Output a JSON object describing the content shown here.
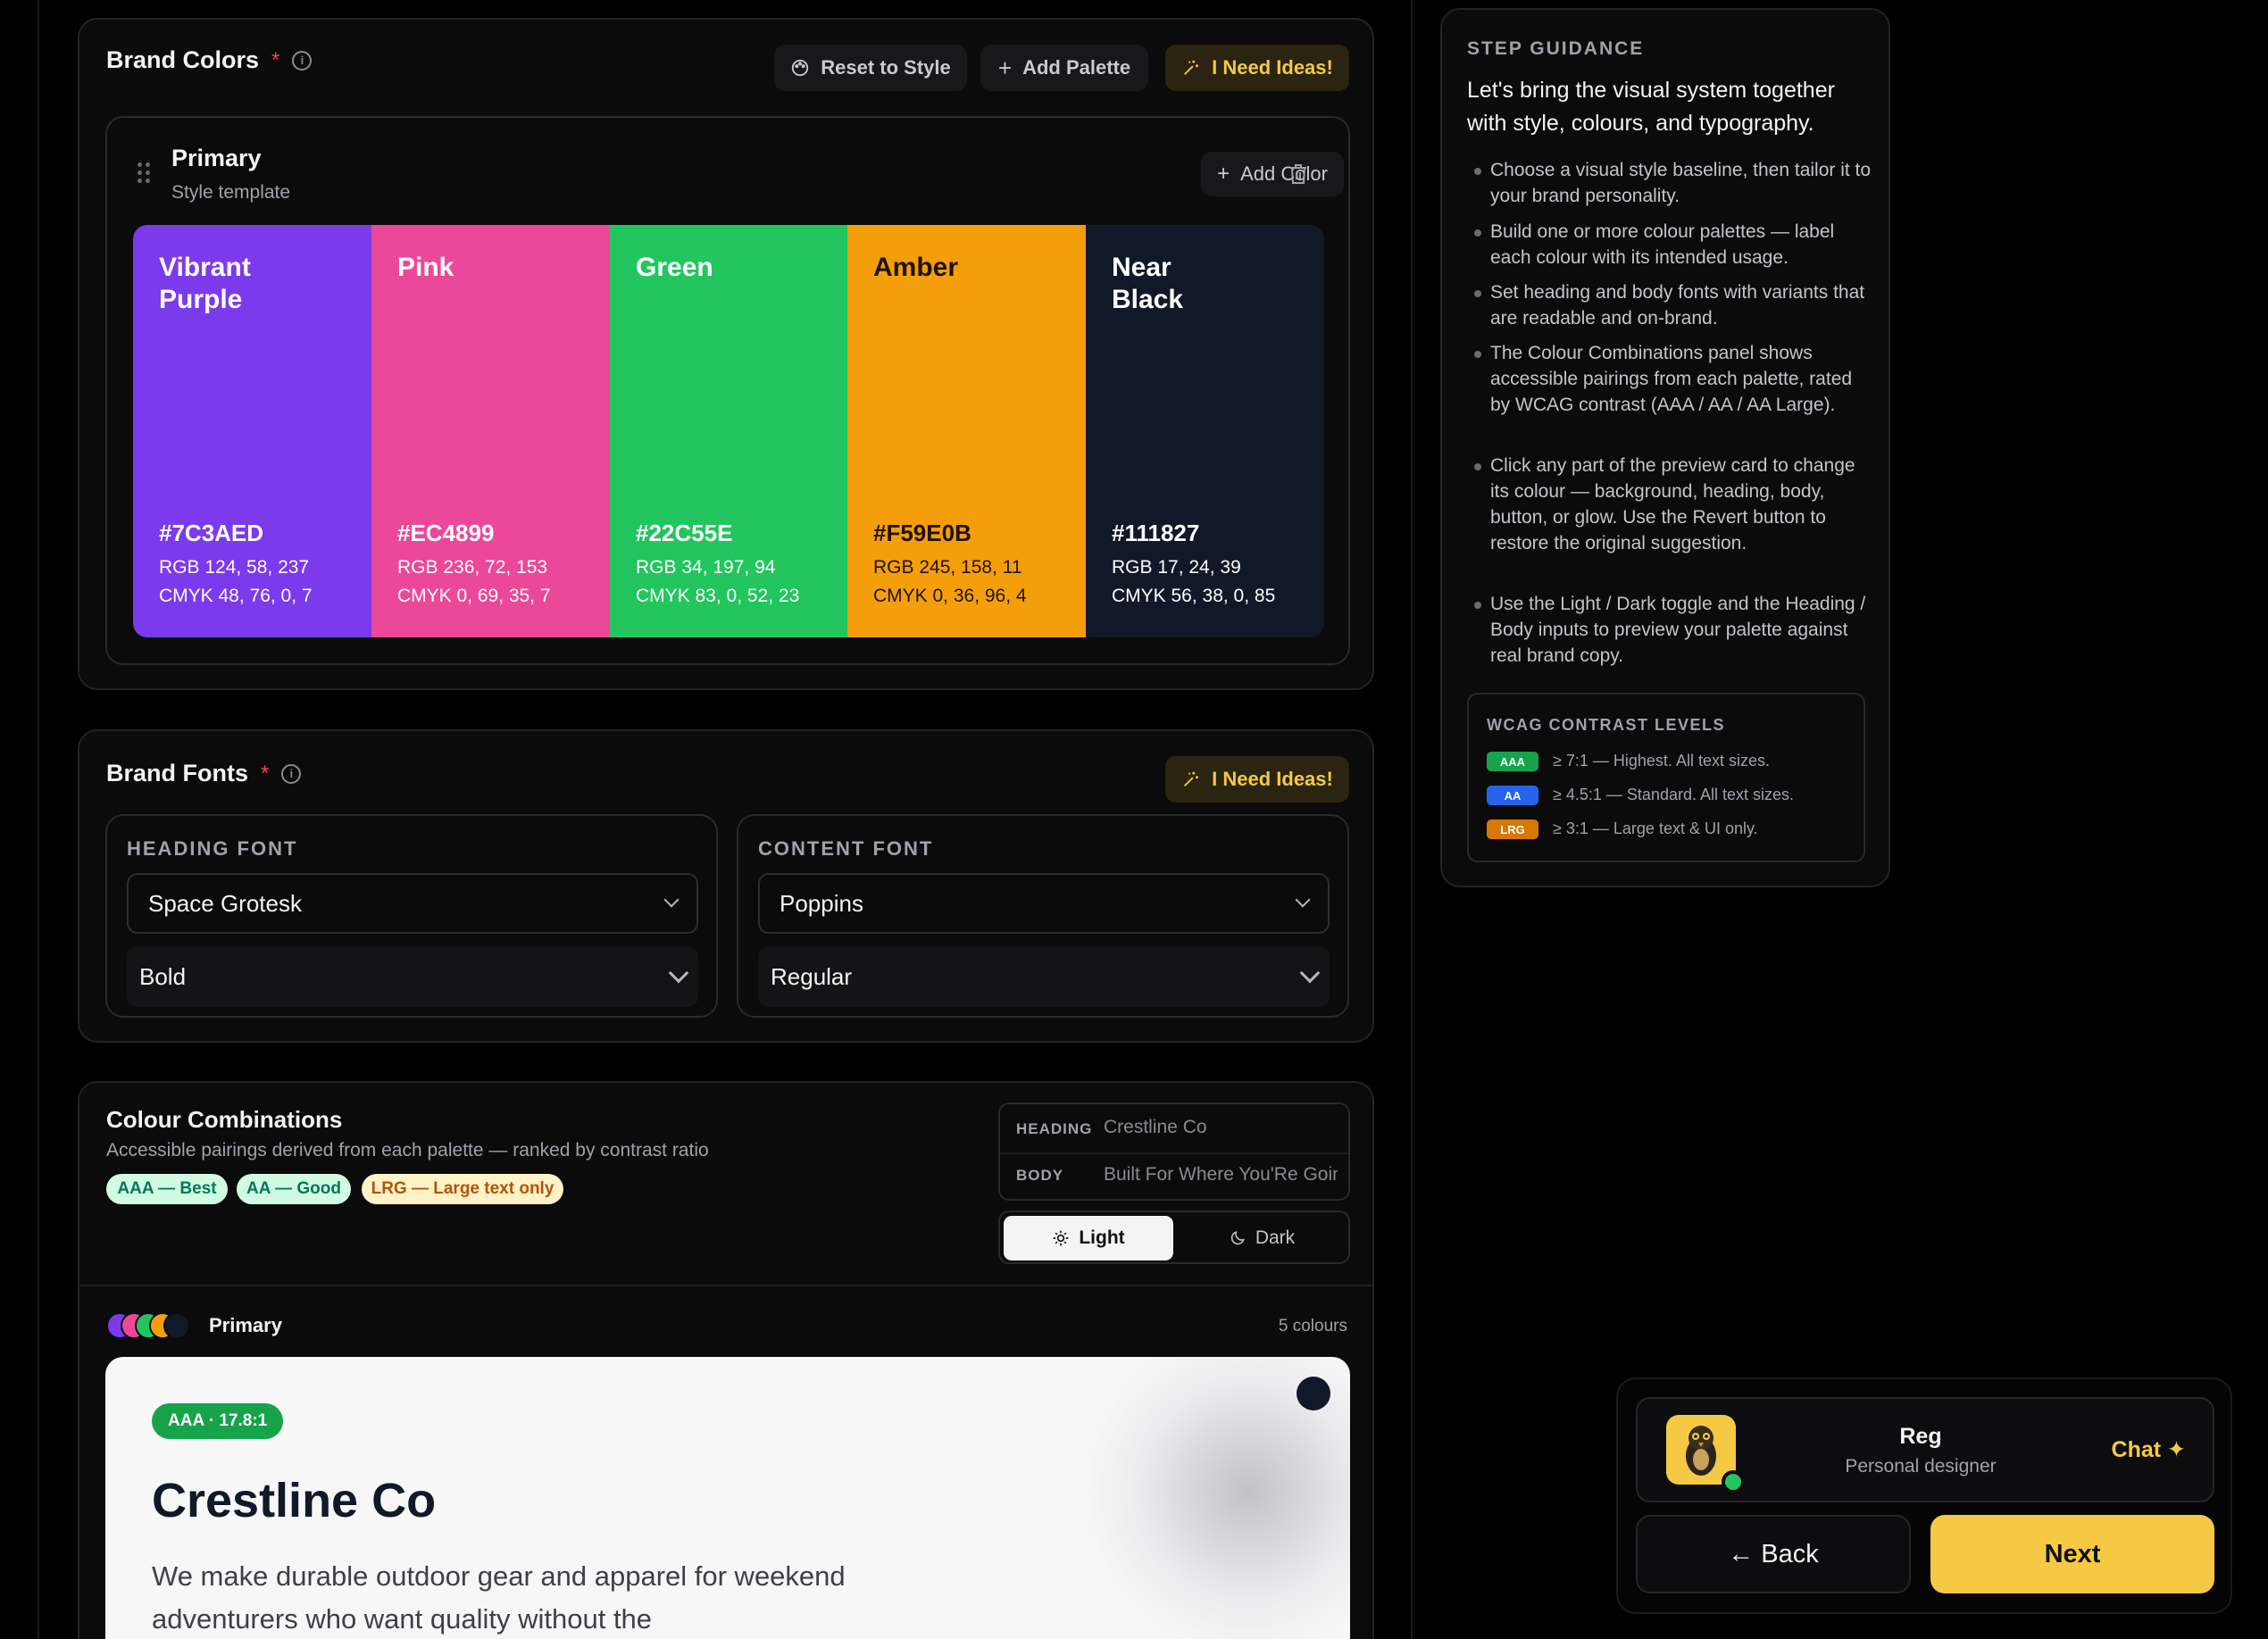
{
  "brand_colors": {
    "title": "Brand Colors",
    "required_mark": "*",
    "info": "i",
    "reset_label": "Reset to Style",
    "add_palette_label": "Add Palette",
    "ideas_label": "I Need Ideas!",
    "palette": {
      "name": "Primary",
      "subtitle": "Style template",
      "add_color_label": "Add Color",
      "swatches": [
        {
          "name": "Vibrant Purple",
          "hex": "#7C3AED",
          "rgb": "RGB 124, 58, 237",
          "cmyk": "CMYK 48, 76, 0, 7",
          "color": "#7C3AED"
        },
        {
          "name": "Pink",
          "hex": "#EC4899",
          "rgb": "RGB 236, 72, 153",
          "cmyk": "CMYK 0, 69, 35, 7",
          "color": "#EC4899"
        },
        {
          "name": "Green",
          "hex": "#22C55E",
          "rgb": "RGB 34, 197, 94",
          "cmyk": "CMYK 83, 0, 52, 23",
          "color": "#22C55E"
        },
        {
          "name": "Amber",
          "hex": "#F59E0B",
          "rgb": "RGB 245, 158, 11",
          "cmyk": "CMYK 0, 36, 96, 4",
          "color": "#F59E0B"
        },
        {
          "name": "Near Black",
          "hex": "#111827",
          "rgb": "RGB 17, 24, 39",
          "cmyk": "CMYK 56, 38, 0, 85",
          "color": "#111827"
        }
      ]
    }
  },
  "brand_fonts": {
    "title": "Brand Fonts",
    "required_mark": "*",
    "ideas_label": "I Need Ideas!",
    "heading": {
      "label": "HEADING FONT",
      "family": "Space Grotesk",
      "weight": "Bold"
    },
    "content": {
      "label": "CONTENT FONT",
      "family": "Poppins",
      "weight": "Regular"
    }
  },
  "combinations": {
    "title": "Colour Combinations",
    "subtitle": "Accessible pairings derived from each palette — ranked by contrast ratio",
    "pills": [
      {
        "label": "AAA — Best",
        "bg": "#d1fae5",
        "fg": "#047857"
      },
      {
        "label": "AA — Good",
        "bg": "#d1fae5",
        "fg": "#047857"
      },
      {
        "label": "LRG — Large text only",
        "bg": "#fef3c7",
        "fg": "#b45309"
      }
    ],
    "heading_label": "HEADING",
    "heading_value": "Crestline Co",
    "body_label": "BODY",
    "body_value": "Built For Where You'Re Going",
    "light_label": "Light",
    "dark_label": "Dark",
    "palette_name": "Primary",
    "palette_count": "5 colours",
    "preview": {
      "badge": "AAA · 17.8:1",
      "heading": "Crestline Co",
      "body": "We make durable outdoor gear and apparel for weekend adventurers who want quality without the"
    }
  },
  "guidance": {
    "label": "STEP GUIDANCE",
    "headline": "Let's bring the visual system together with style, colours, and typography.",
    "items": [
      "Choose a visual style baseline, then tailor it to your brand personality.",
      "Build one or more colour palettes — label each colour with its intended usage.",
      "Set heading and body fonts with variants that are readable and on-brand.",
      "The Colour Combinations panel shows accessible pairings from each palette, rated by WCAG contrast (AAA / AA / AA Large).",
      "Click any part of the preview card to change its colour — background, heading, body, button, or glow. Use the Revert button to restore the original suggestion.",
      "Use the Light / Dark toggle and the Heading / Body inputs to preview your palette against real brand copy."
    ],
    "wcag_label": "WCAG CONTRAST LEVELS",
    "wcag": [
      {
        "badge": "AAA",
        "text": "≥ 7:1 — Highest. All text sizes.",
        "color": "#16a34a"
      },
      {
        "badge": "AA",
        "text": "≥ 4.5:1 — Standard. All text sizes.",
        "color": "#2563eb"
      },
      {
        "badge": "LRG",
        "text": "≥ 3:1 — Large text & UI only.",
        "color": "#d97706"
      }
    ]
  },
  "assistant": {
    "name": "Reg",
    "role": "Personal designer",
    "chat_label": "Chat ✦",
    "back_label": "← Back",
    "next_label": "Next"
  }
}
